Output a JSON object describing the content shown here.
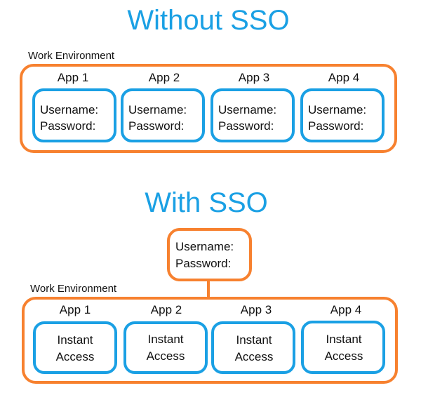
{
  "colors": {
    "title": "#1aa0e4",
    "environment_border": "#f7812f",
    "app_border": "#1aa0e4",
    "text": "#111111"
  },
  "without_sso": {
    "title": "Without SSO",
    "environment_label": "Work Environment",
    "apps": [
      {
        "name": "App 1",
        "lines": [
          "Username:",
          "Password:"
        ]
      },
      {
        "name": "App 2",
        "lines": [
          "Username:",
          "Password:"
        ]
      },
      {
        "name": "App 3",
        "lines": [
          "Username:",
          "Password:"
        ]
      },
      {
        "name": "App 4",
        "lines": [
          "Username:",
          "Password:"
        ]
      }
    ]
  },
  "with_sso": {
    "title": "With SSO",
    "credentials": {
      "lines": [
        "Username:",
        "Password:"
      ]
    },
    "environment_label": "Work Environment",
    "apps": [
      {
        "name": "App 1",
        "lines": [
          "Instant",
          "Access"
        ]
      },
      {
        "name": "App 2",
        "lines": [
          "Instant",
          "Access"
        ]
      },
      {
        "name": "App 3",
        "lines": [
          "Instant",
          "Access"
        ]
      },
      {
        "name": "App 4",
        "lines": [
          "Instant",
          "Access"
        ]
      }
    ]
  }
}
